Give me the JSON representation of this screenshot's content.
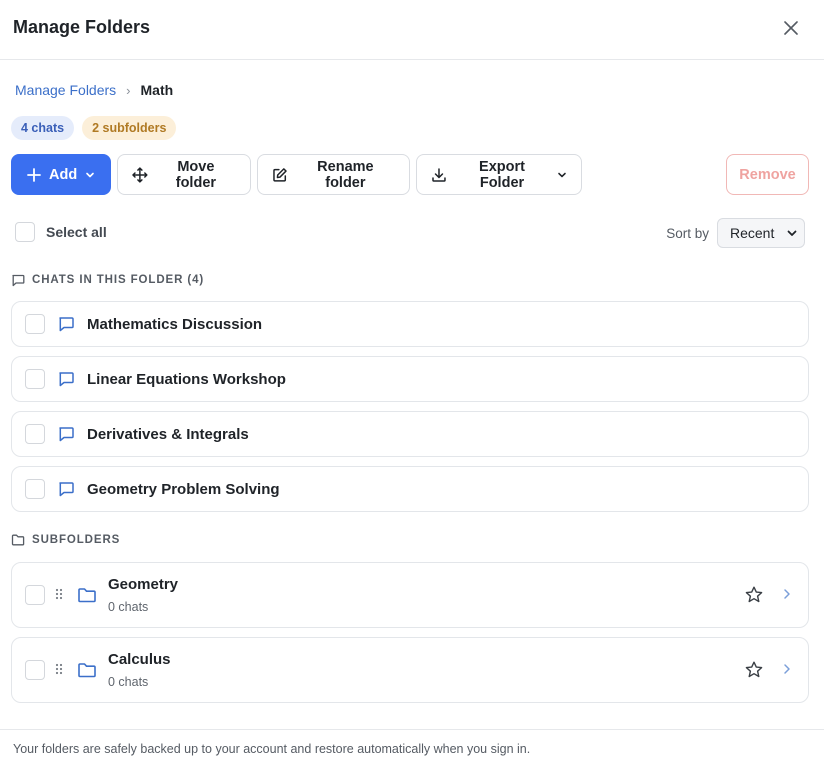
{
  "dialog": {
    "title": "Manage Folders"
  },
  "breadcrumb": {
    "parent": "Manage Folders",
    "separator": "›",
    "current": "Math"
  },
  "badges": {
    "chats": "4 chats",
    "subfolders": "2 subfolders"
  },
  "toolbar": {
    "add_label": "Add",
    "move_label": "Move folder",
    "rename_label": "Rename folder",
    "export_label": "Export Folder",
    "remove_label": "Remove"
  },
  "selection": {
    "select_all_label": "Select all"
  },
  "sort": {
    "label": "Sort by",
    "selected": "Recent"
  },
  "chats_section": {
    "heading": "CHATS IN THIS FOLDER (4)",
    "items": [
      {
        "title": "Mathematics Discussion"
      },
      {
        "title": "Linear Equations Workshop"
      },
      {
        "title": "Derivatives & Integrals"
      },
      {
        "title": "Geometry Problem Solving"
      }
    ]
  },
  "subfolders_section": {
    "heading": "SUBFOLDERS",
    "items": [
      {
        "name": "Geometry",
        "count": "0 chats"
      },
      {
        "name": "Calculus",
        "count": "0 chats"
      }
    ]
  },
  "footer": {
    "text": "Your folders are safely backed up to your account and restore automatically when you sign in."
  },
  "colors": {
    "accent": "#3a6ff0",
    "link": "#3b6fc9",
    "remove": "#efa3a0"
  },
  "icons": [
    "close-icon",
    "plus-icon",
    "chevron-down-icon",
    "move-icon",
    "edit-icon",
    "download-icon",
    "chat-bubble-icon",
    "folder-icon",
    "drag-handle-icon",
    "star-icon",
    "chevron-right-icon"
  ]
}
